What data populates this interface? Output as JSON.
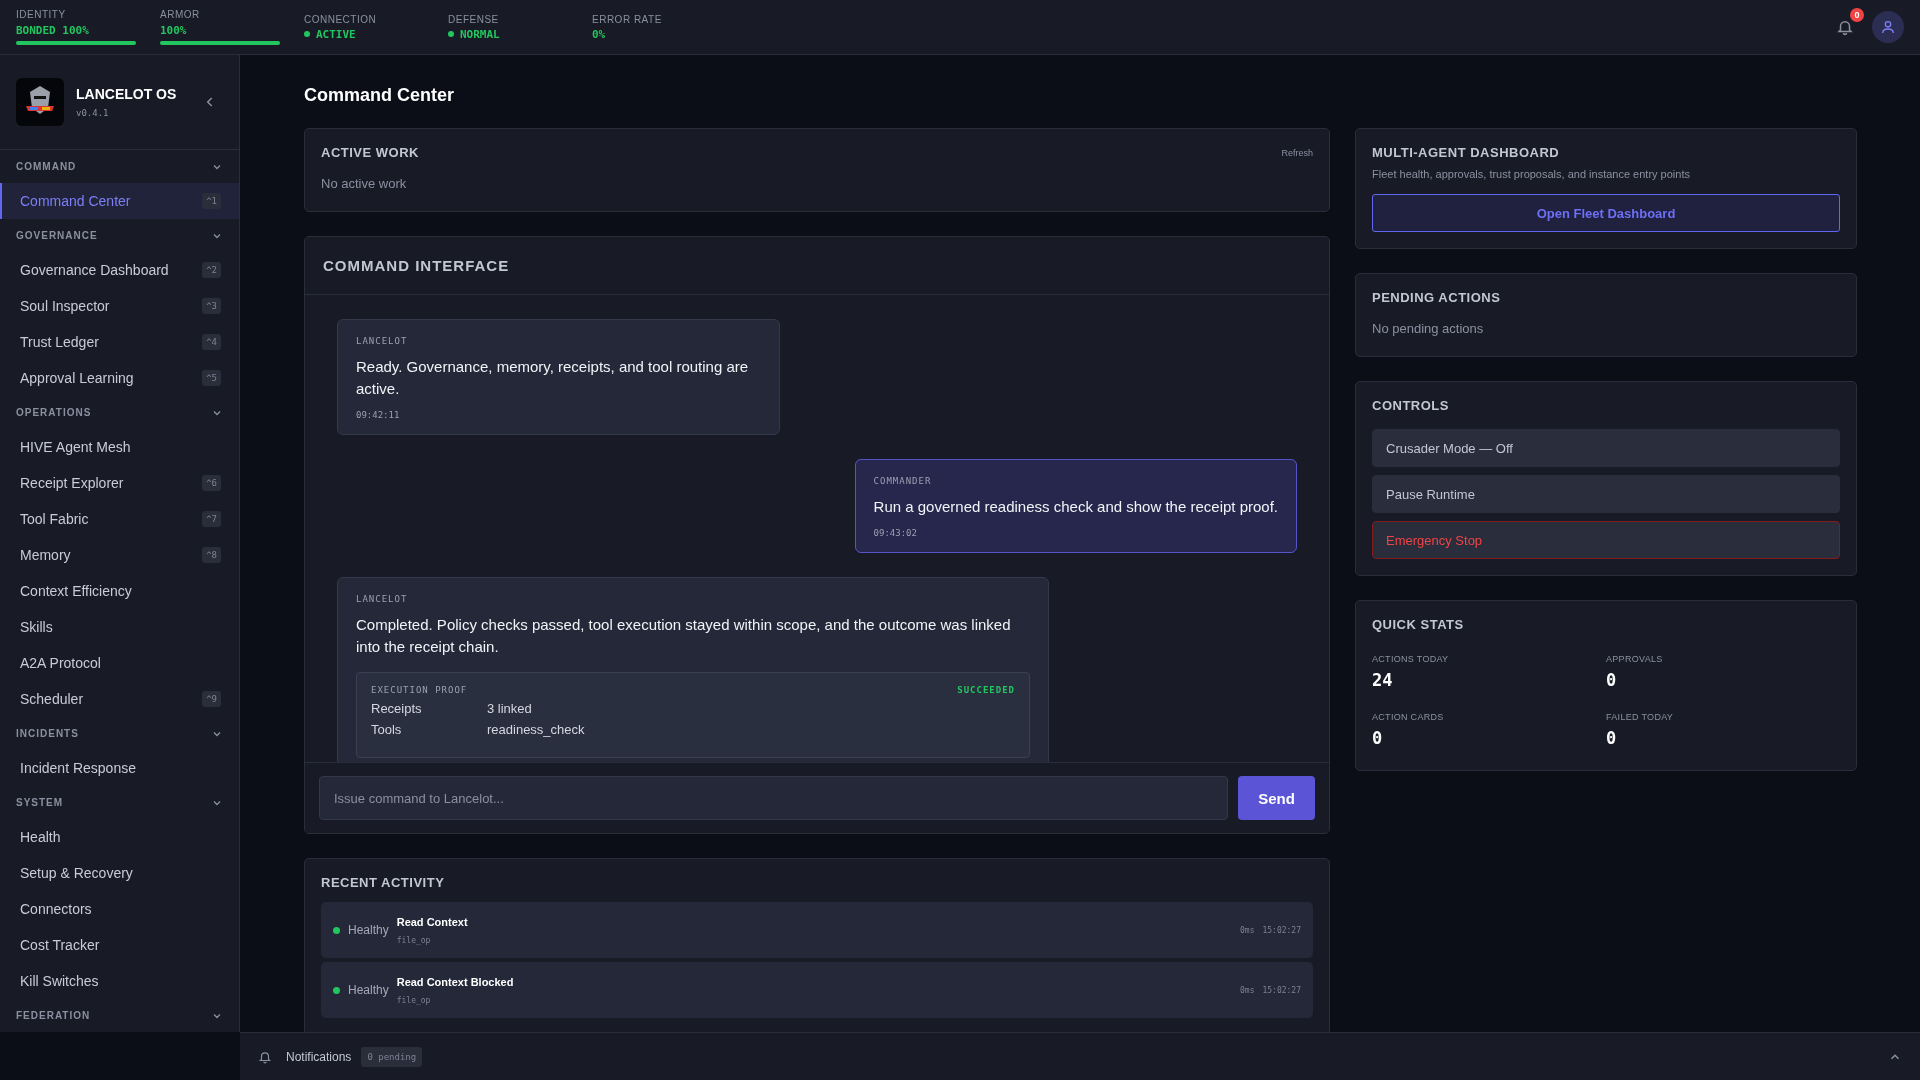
{
  "status_bar": {
    "metrics": [
      {
        "label": "IDENTITY",
        "value": "BONDED 100%",
        "kind": "bar",
        "level": 1
      },
      {
        "label": "ARMOR",
        "value": "100%",
        "kind": "bar",
        "level": 1
      },
      {
        "label": "CONNECTION",
        "value": "ACTIVE",
        "kind": "dot"
      },
      {
        "label": "DEFENSE",
        "value": "NORMAL",
        "kind": "dot"
      },
      {
        "label": "ERROR RATE",
        "value": "0%",
        "kind": "plain"
      }
    ],
    "notification_count": "0"
  },
  "sidebar": {
    "app_name": "LANCELOT OS",
    "version": "v0.4.1",
    "sections": [
      {
        "title": "COMMAND",
        "items": [
          {
            "label": "Command Center",
            "shortcut": "^1",
            "selected": true
          }
        ]
      },
      {
        "title": "GOVERNANCE",
        "items": [
          {
            "label": "Governance Dashboard",
            "shortcut": "^2",
            "selected": false
          },
          {
            "label": "Soul Inspector",
            "shortcut": "^3",
            "selected": false
          },
          {
            "label": "Trust Ledger",
            "shortcut": "^4",
            "selected": false
          },
          {
            "label": "Approval Learning",
            "shortcut": "^5",
            "selected": false
          }
        ]
      },
      {
        "title": "OPERATIONS",
        "items": [
          {
            "label": "HIVE Agent Mesh",
            "selected": false
          },
          {
            "label": "Receipt Explorer",
            "shortcut": "^6",
            "selected": false
          },
          {
            "label": "Tool Fabric",
            "shortcut": "^7",
            "selected": false
          },
          {
            "label": "Memory",
            "shortcut": "^8",
            "selected": false
          },
          {
            "label": "Context Efficiency",
            "selected": false
          },
          {
            "label": "Skills",
            "selected": false
          },
          {
            "label": "A2A Protocol",
            "selected": false
          },
          {
            "label": "Scheduler",
            "shortcut": "^9",
            "selected": false
          }
        ]
      },
      {
        "title": "INCIDENTS",
        "items": [
          {
            "label": "Incident Response",
            "selected": false
          }
        ]
      },
      {
        "title": "SYSTEM",
        "items": [
          {
            "label": "Health",
            "selected": false
          },
          {
            "label": "Setup & Recovery",
            "selected": false
          },
          {
            "label": "Connectors",
            "selected": false
          },
          {
            "label": "Cost Tracker",
            "selected": false
          },
          {
            "label": "Kill Switches",
            "selected": false
          }
        ]
      },
      {
        "title": "FEDERATION"
      }
    ]
  },
  "page_title": "Command Center",
  "active_work": {
    "title": "ACTIVE WORK",
    "refresh": "Refresh",
    "empty": "No active work"
  },
  "command_interface": {
    "title": "COMMAND INTERFACE",
    "messages": [
      {
        "kind": "agent",
        "sender": "LANCELOT",
        "text": "Ready. Governance, memory, receipts, and tool routing are active.",
        "time": "09:42:11"
      },
      {
        "kind": "user",
        "sender": "COMMANDER",
        "text": "Run a governed readiness check and show the receipt proof.",
        "time": "09:43:02"
      },
      {
        "kind": "agent",
        "sender": "LANCELOT",
        "text": "Completed. Policy checks passed, tool execution stayed within scope, and the outcome was linked into the receipt chain.",
        "proof": {
          "title": "EXECUTION PROOF",
          "status": "SUCCEEDED",
          "rows": [
            {
              "label": "Receipts",
              "value": "3 linked"
            },
            {
              "label": "Tools",
              "value": "readiness_check"
            }
          ]
        }
      }
    ],
    "input_placeholder": "Issue command to Lancelot...",
    "send": "Send"
  },
  "recent_activity": {
    "title": "RECENT ACTIVITY",
    "items": [
      {
        "status": "Healthy",
        "color": "#22c55e",
        "title": "Read Context",
        "type": "file_op",
        "duration": "0ms",
        "time": "15:02:27"
      },
      {
        "status": "Healthy",
        "color": "#22c55e",
        "title": "Read Context Blocked",
        "type": "file_op",
        "duration": "0ms",
        "time": "15:02:27"
      }
    ]
  },
  "multi_agent": {
    "title": "MULTI-AGENT DASHBOARD",
    "description": "Fleet health, approvals, trust proposals, and instance entry points",
    "button": "Open Fleet Dashboard"
  },
  "pending_actions": {
    "title": "PENDING ACTIONS",
    "empty": "No pending actions"
  },
  "controls": {
    "title": "CONTROLS",
    "buttons": [
      {
        "label": "Crusader Mode — Off",
        "kind": "normal"
      },
      {
        "label": "Pause Runtime",
        "kind": "normal"
      },
      {
        "label": "Emergency Stop",
        "kind": "danger"
      }
    ]
  },
  "quick_stats": {
    "title": "QUICK STATS",
    "stats": [
      {
        "label": "ACTIONS TODAY",
        "value": "24"
      },
      {
        "label": "APPROVALS",
        "value": "0"
      },
      {
        "label": "ACTION CARDS",
        "value": "0"
      },
      {
        "label": "FAILED TODAY",
        "value": "0"
      }
    ]
  },
  "notifications_bar": {
    "label": "Notifications",
    "badge": "0 pending"
  }
}
